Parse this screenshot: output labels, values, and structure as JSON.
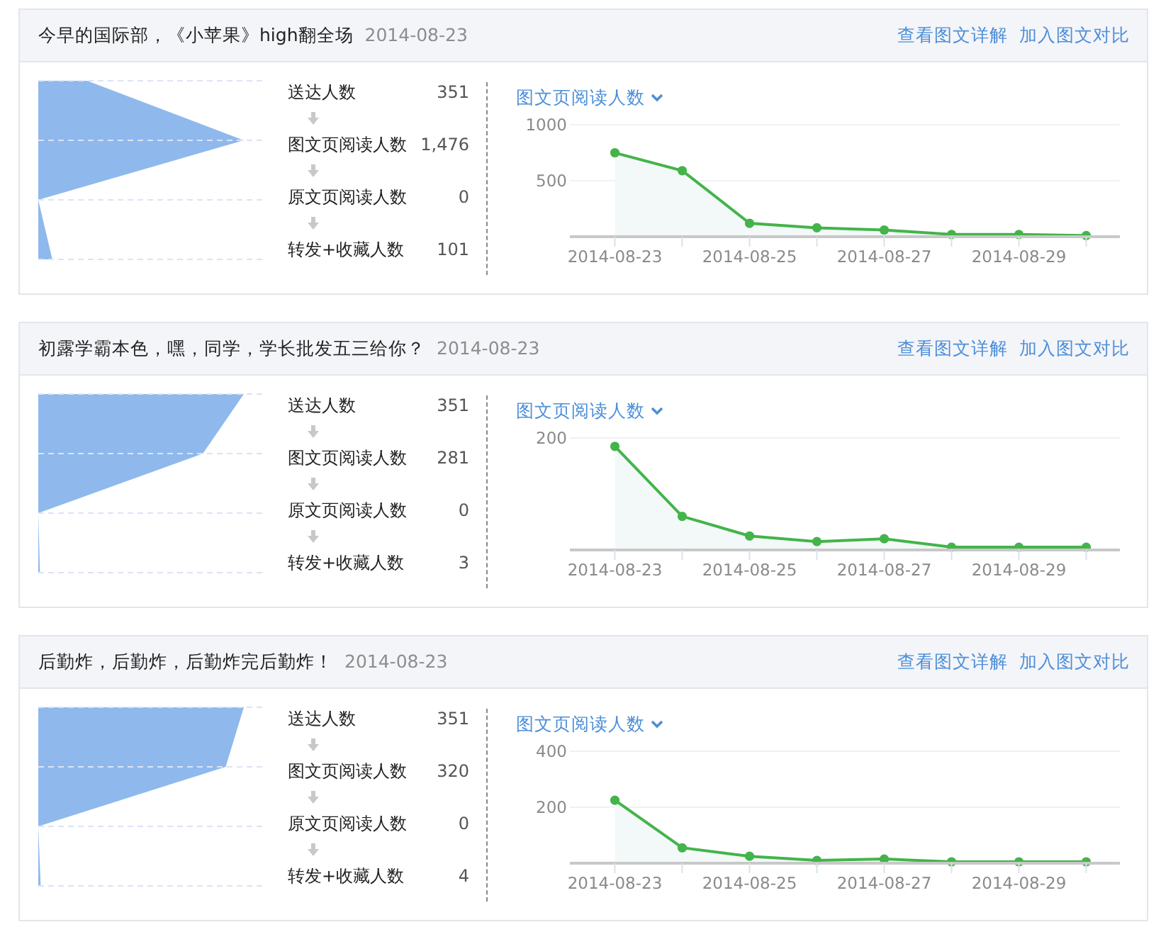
{
  "articles": [
    {
      "title": "今早的国际部，《小苹果》high翻全场",
      "date": "2014-08-23",
      "links": [
        "查看图文详解",
        "加入图文对比"
      ],
      "funnel": [
        {
          "label": "送达人数",
          "value": "351"
        },
        {
          "label": "图文页阅读人数",
          "value": "1,476"
        },
        {
          "label": "原文页阅读人数",
          "value": "0"
        },
        {
          "label": "转发+收藏人数",
          "value": "101"
        }
      ],
      "metric_selector": "图文页阅读人数",
      "chart_data": {
        "type": "area",
        "categories": [
          "2014-08-23",
          null,
          "2014-08-25",
          null,
          "2014-08-27",
          null,
          "2014-08-29",
          null
        ],
        "series": [
          {
            "color": "#43b449",
            "values": [
              750,
              590,
              120,
              80,
              60,
              20,
              20,
              10
            ]
          }
        ],
        "ylim": [
          0,
          1000
        ],
        "yticks": [
          500,
          1000
        ]
      }
    },
    {
      "title": "初露学霸本色，嘿，同学，学长批发五三给你？",
      "date": "2014-08-23",
      "links": [
        "查看图文详解",
        "加入图文对比"
      ],
      "funnel": [
        {
          "label": "送达人数",
          "value": "351"
        },
        {
          "label": "图文页阅读人数",
          "value": "281"
        },
        {
          "label": "原文页阅读人数",
          "value": "0"
        },
        {
          "label": "转发+收藏人数",
          "value": "3"
        }
      ],
      "metric_selector": "图文页阅读人数",
      "chart_data": {
        "type": "area",
        "categories": [
          "2014-08-23",
          null,
          "2014-08-25",
          null,
          "2014-08-27",
          null,
          "2014-08-29",
          null
        ],
        "series": [
          {
            "color": "#43b449",
            "values": [
              185,
              60,
              25,
              15,
              20,
              5,
              5,
              5
            ]
          }
        ],
        "ylim": [
          0,
          200
        ],
        "yticks": [
          200
        ]
      }
    },
    {
      "title": "后勤炸，后勤炸，后勤炸完后勤炸！",
      "date": "2014-08-23",
      "links": [
        "查看图文详解",
        "加入图文对比"
      ],
      "funnel": [
        {
          "label": "送达人数",
          "value": "351"
        },
        {
          "label": "图文页阅读人数",
          "value": "320"
        },
        {
          "label": "原文页阅读人数",
          "value": "0"
        },
        {
          "label": "转发+收藏人数",
          "value": "4"
        }
      ],
      "metric_selector": "图文页阅读人数",
      "chart_data": {
        "type": "area",
        "categories": [
          "2014-08-23",
          null,
          "2014-08-25",
          null,
          "2014-08-27",
          null,
          "2014-08-29",
          null
        ],
        "series": [
          {
            "color": "#43b449",
            "values": [
              225,
              55,
              25,
              10,
              15,
              5,
              5,
              5
            ]
          }
        ],
        "ylim": [
          0,
          400
        ],
        "yticks": [
          200,
          400
        ]
      }
    }
  ]
}
